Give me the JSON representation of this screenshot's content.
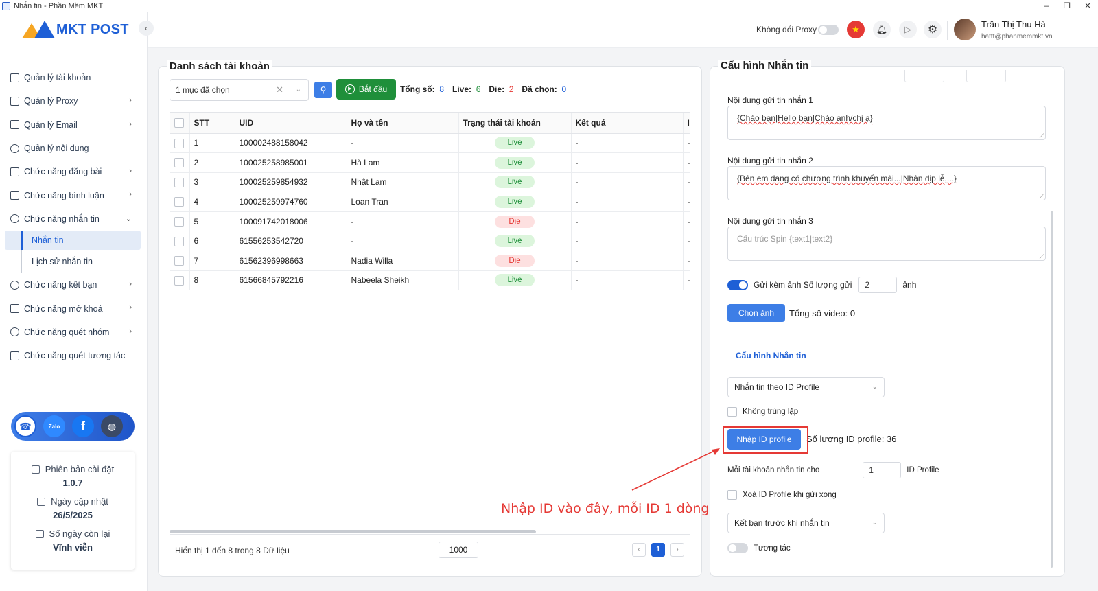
{
  "window": {
    "title": "Nhắn tin - Phần Mềm MKT",
    "controls": [
      "–",
      "❐",
      "✕"
    ]
  },
  "logo": {
    "text": "MKT POST"
  },
  "sidebar": {
    "items": [
      {
        "label": "Quản lý tài khoản",
        "icon": "grid-icon",
        "chevron": ""
      },
      {
        "label": "Quản lý Proxy",
        "icon": "layers-icon",
        "chevron": "›"
      },
      {
        "label": "Quản lý Email",
        "icon": "mail-icon",
        "chevron": "›"
      },
      {
        "label": "Quản lý nội dung",
        "icon": "link-icon",
        "chevron": ""
      },
      {
        "label": "Chức năng đăng bài",
        "icon": "post-icon",
        "chevron": "›"
      },
      {
        "label": "Chức năng bình luận",
        "icon": "comment-icon",
        "chevron": "›"
      },
      {
        "label": "Chức năng nhắn tin",
        "icon": "chat-icon",
        "chevron": "⌄"
      }
    ],
    "submenu": [
      {
        "label": "Nhắn tin",
        "active": true
      },
      {
        "label": "Lịch sử nhắn tin",
        "active": false
      }
    ],
    "items_after": [
      {
        "label": "Chức năng kết bạn",
        "icon": "user-add-icon",
        "chevron": "›"
      },
      {
        "label": "Chức năng mở khoá",
        "icon": "lock-icon",
        "chevron": "›"
      },
      {
        "label": "Chức năng quét nhóm",
        "icon": "group-icon",
        "chevron": "›"
      },
      {
        "label": "Chức năng quét tương tác",
        "icon": "scan-icon",
        "chevron": ""
      }
    ]
  },
  "social": {
    "zalo": "Zalo",
    "facebook": "f"
  },
  "info_card": {
    "version_label": "Phiên bản cài đặt",
    "version_value": "1.0.7",
    "update_label": "Ngày cập nhật",
    "update_value": "26/5/2025",
    "days_label": "Số ngày còn lại",
    "days_value": "Vĩnh viễn"
  },
  "header": {
    "proxy_label": "Không đổi Proxy",
    "user_name": "Trần Thị Thu Hà",
    "user_email": "hattt@phanmemmkt.vn"
  },
  "left_panel": {
    "title": "Danh sách tài khoản",
    "select_value": "1 mục đã chọn",
    "start_label": "Bắt đầu",
    "stats": {
      "total_label": "Tổng số:",
      "total": "8",
      "live_label": "Live:",
      "live": "6",
      "die_label": "Die:",
      "die": "2",
      "selected_label": "Đã chọn:",
      "selected": "0"
    },
    "columns": [
      "STT",
      "UID",
      "Họ và tên",
      "Trạng thái tài khoản",
      "Kết quả",
      "I"
    ],
    "rows": [
      {
        "stt": "1",
        "uid": "100002488158042",
        "name": "-",
        "status": "Live",
        "result": "-",
        "extra": "-"
      },
      {
        "stt": "2",
        "uid": "100025258985001",
        "name": "Hà Lam",
        "status": "Live",
        "result": "-",
        "extra": "-"
      },
      {
        "stt": "3",
        "uid": "100025259854932",
        "name": "Nhật Lam",
        "status": "Live",
        "result": "-",
        "extra": "-"
      },
      {
        "stt": "4",
        "uid": "100025259974760",
        "name": "Loan Tran",
        "status": "Live",
        "result": "-",
        "extra": "-"
      },
      {
        "stt": "5",
        "uid": "100091742018006",
        "name": "-",
        "status": "Die",
        "result": "-",
        "extra": "-"
      },
      {
        "stt": "6",
        "uid": "61556253542720",
        "name": "-",
        "status": "Live",
        "result": "-",
        "extra": "-"
      },
      {
        "stt": "7",
        "uid": "61562396998663",
        "name": "Nadia Willa",
        "status": "Die",
        "result": "-",
        "extra": "-"
      },
      {
        "stt": "8",
        "uid": "61566845792216",
        "name": "Nabeela Sheikh",
        "status": "Live",
        "result": "-",
        "extra": "-"
      }
    ],
    "footer_text": "Hiển thị 1 đến 8 trong 8 Dữ liệu",
    "page_size": "1000",
    "current_page": "1"
  },
  "right_panel": {
    "title": "Cấu hình Nhắn tin",
    "msg1_label": "Nội dung gửi tin nhắn 1",
    "msg1_value": "{Chào bạn|Hello bạn|Chào anh/chị ạ}",
    "msg2_label": "Nội dung gửi tin nhắn 2",
    "msg2_value": "{Bên em đang có chương trình khuyến mãi...|Nhân dịp lễ,...}",
    "msg3_label": "Nội dung gửi tin nhắn 3",
    "msg3_placeholder": "Cấu trúc Spin {text1|text2}",
    "send_image_label": "Gửi kèm ảnh Số lượng gửi",
    "send_image_count": "2",
    "send_image_unit": "ảnh",
    "choose_image_label": "Chọn ảnh",
    "total_video_label": "Tổng số video: 0",
    "section_title": "Cấu hình Nhắn tin",
    "mode_value": "Nhắn tin theo ID Profile",
    "no_duplicate_label": "Không trùng lặp",
    "import_id_label": "Nhập ID profile",
    "id_count_label": "Số lượng ID profile: 36",
    "per_account_label": "Mỗi tài khoản nhắn tin cho",
    "per_account_value": "1",
    "per_account_unit": "ID Profile",
    "delete_after_label": "Xoá ID Profile khi gửi xong",
    "friend_mode_value": "Kết bạn trước khi nhắn tin",
    "interact_label": "Tương tác"
  },
  "annotation": {
    "text": "Nhập ID vào đây, mỗi ID 1 dòng",
    "color": "#e53935"
  }
}
